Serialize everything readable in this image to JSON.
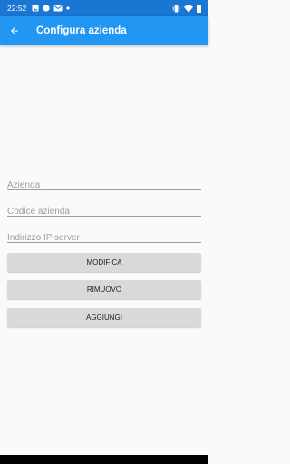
{
  "status_bar": {
    "time": "22:52",
    "left_icons": [
      "image-icon",
      "circle-icon",
      "mail-icon",
      "dot-icon"
    ],
    "right_icons": [
      "vibrate-icon",
      "wifi-icon",
      "battery-icon"
    ]
  },
  "app_bar": {
    "back_icon": "arrow-back-icon",
    "title": "Configura azienda"
  },
  "form": {
    "azienda_placeholder": "Azienda",
    "codice_placeholder": "Codice azienda",
    "ip_placeholder": "Indirizzo IP server",
    "azienda_value": "",
    "codice_value": "",
    "ip_value": ""
  },
  "buttons": {
    "modifica": "MODIFICA",
    "rimuovo": "RIMUOVO",
    "aggiungi": "AGGIUNGI"
  },
  "colors": {
    "status_bar": "#1976d2",
    "app_bar": "#2196f3",
    "background": "#fafafa",
    "button": "#d9d9d9"
  }
}
